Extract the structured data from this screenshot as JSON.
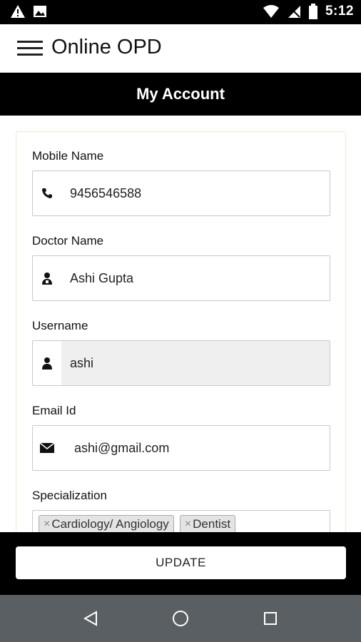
{
  "status_bar": {
    "time": "5:12",
    "left_icons": [
      "warning-icon",
      "image-icon"
    ],
    "right_icons": [
      "wifi-icon",
      "no-signal-icon",
      "battery-icon"
    ]
  },
  "app_bar": {
    "title": "Online OPD",
    "menu_icon": "hamburger-menu-icon"
  },
  "section": {
    "title": "My Account"
  },
  "form": {
    "mobile": {
      "label": "Mobile Name",
      "value": "9456546588",
      "icon": "phone-icon"
    },
    "doctor": {
      "label": "Doctor Name",
      "value": "Ashi Gupta",
      "icon": "doctor-icon"
    },
    "username": {
      "label": "Username",
      "value": "ashi",
      "icon": "user-icon",
      "readonly": true
    },
    "email": {
      "label": "Email Id",
      "value": "ashi@gmail.com",
      "icon": "envelope-icon"
    },
    "specialization": {
      "label": "Specialization",
      "chips": [
        {
          "remove": "×",
          "label": "Cardiology/ Angiology"
        },
        {
          "remove": "×",
          "label": "Dentist"
        }
      ]
    }
  },
  "actions": {
    "update_label": "UPDATE"
  },
  "nav_bar": {
    "icons": [
      "back-icon",
      "home-icon",
      "recents-icon"
    ]
  },
  "colors": {
    "header_bg": "#000000",
    "navbar_bg": "#595f63",
    "field_border": "#c9c9c9",
    "readonly_bg": "#efefef",
    "chip_bg": "#e4e4e4"
  }
}
